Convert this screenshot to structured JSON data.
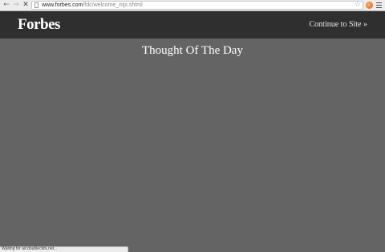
{
  "browser": {
    "url_host": "www.forbes.com",
    "url_path": "/fdc/welcome_mjx.shtml",
    "back_glyph": "←",
    "forward_glyph": "→",
    "stop_glyph": "✕",
    "star_glyph": "☆",
    "status_text": "Waiting for ad.doubleclick.net..."
  },
  "header": {
    "logo": "Forbes",
    "continue_label": "Continue to Site »"
  },
  "main": {
    "title": "Thought Of The Day"
  },
  "colors": {
    "header_bg": "#2f2f2f",
    "page_bg": "#646464",
    "text": "#ffffff"
  }
}
